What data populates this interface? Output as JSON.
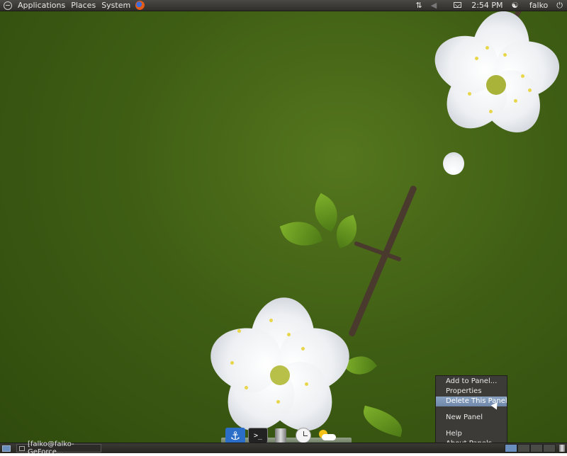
{
  "top_panel": {
    "menus": [
      "Applications",
      "Places",
      "System"
    ],
    "logo_icon": "ubuntu-logo-icon",
    "browser_icon": "firefox-icon",
    "tray": {
      "network_icon": "network-arrows-icon",
      "volume_icon": "speaker-icon",
      "mail_icon": "mail-icon",
      "time": "2:54 PM",
      "user": "falko",
      "power_icon": "power-icon"
    }
  },
  "dock": {
    "items": [
      {
        "name": "anchor-icon",
        "glyph": "⚓"
      },
      {
        "name": "terminal-icon",
        "glyph": ">_"
      },
      {
        "name": "trash-icon",
        "glyph": ""
      },
      {
        "name": "clock-icon",
        "glyph": ""
      },
      {
        "name": "weather-icon",
        "glyph": ""
      }
    ]
  },
  "context_menu": {
    "items": [
      "Add to Panel...",
      "Properties",
      "Delete This Panel",
      "New Panel",
      "Help",
      "About Panels"
    ],
    "active_index": 2
  },
  "bottom_panel": {
    "task": "[falko@falko-GeForce...",
    "workspaces": 4,
    "active_workspace": 0
  },
  "colors": {
    "panel": "#3c3b37",
    "highlight": "#8aa3c2",
    "desktop": "#4a6a18"
  }
}
